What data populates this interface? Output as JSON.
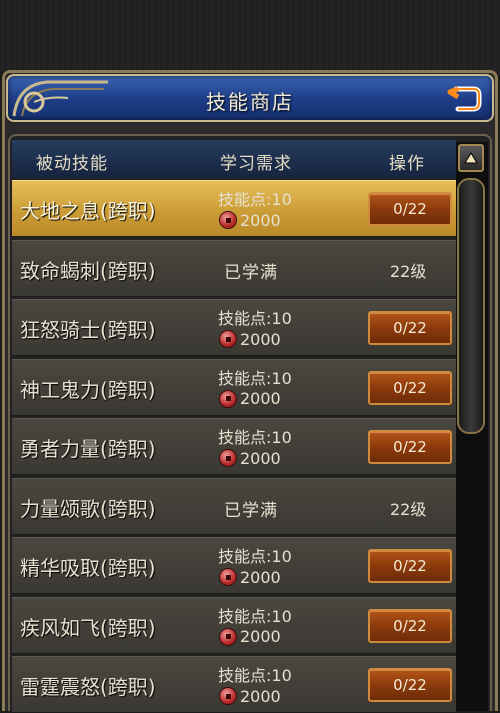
{
  "window": {
    "title": "技能商店",
    "back_icon": "return-arrow-icon"
  },
  "table": {
    "headers": {
      "skill": "被动技能",
      "requirement": "学习需求",
      "action": "操作"
    }
  },
  "skills": [
    {
      "name": "大地之息(跨职)",
      "state": "learnable",
      "selected": true,
      "requirement": "技能点:10",
      "cost": "2000",
      "action": "0/22"
    },
    {
      "name": "致命蝎刺(跨职)",
      "state": "maxed",
      "selected": false,
      "status": "已学满",
      "level": "22级"
    },
    {
      "name": "狂怒骑士(跨职)",
      "state": "learnable",
      "selected": false,
      "requirement": "技能点:10",
      "cost": "2000",
      "action": "0/22"
    },
    {
      "name": "神工鬼力(跨职)",
      "state": "learnable",
      "selected": false,
      "requirement": "技能点:10",
      "cost": "2000",
      "action": "0/22"
    },
    {
      "name": "勇者力量(跨职)",
      "state": "learnable",
      "selected": false,
      "requirement": "技能点:10",
      "cost": "2000",
      "action": "0/22"
    },
    {
      "name": "力量颂歌(跨职)",
      "state": "maxed",
      "selected": false,
      "status": "已学满",
      "level": "22级"
    },
    {
      "name": "精华吸取(跨职)",
      "state": "learnable",
      "selected": false,
      "requirement": "技能点:10",
      "cost": "2000",
      "action": "0/22"
    },
    {
      "name": "疾风如飞(跨职)",
      "state": "learnable",
      "selected": false,
      "requirement": "技能点:10",
      "cost": "2000",
      "action": "0/22"
    },
    {
      "name": "雷霆震怒(跨职)",
      "state": "learnable",
      "selected": false,
      "requirement": "技能点:10",
      "cost": "2000",
      "action": "0/22"
    }
  ],
  "colors": {
    "title_bar": "#1d3c86",
    "selected_row": "#d4a840",
    "action_button": "#8c3a0c",
    "frame_gold": "#c9b98e"
  }
}
